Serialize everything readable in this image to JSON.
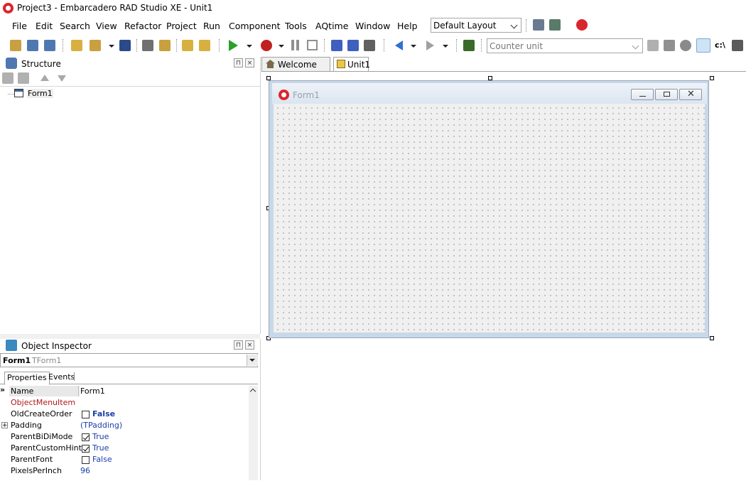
{
  "window": {
    "title": "Project3 - Embarcadero RAD Studio XE - Unit1"
  },
  "menu": [
    "File",
    "Edit",
    "Search",
    "View",
    "Refactor",
    "Project",
    "Run",
    "Component",
    "Tools",
    "AQtime",
    "Window",
    "Help"
  ],
  "toolbar": {
    "layout_combo": "Default Layout",
    "search_combo_placeholder": "Counter unit",
    "path_label": "c:\\"
  },
  "structure": {
    "title": "Structure",
    "tree_item": "Form1"
  },
  "tabs": [
    "Welcome Page",
    "Unit1"
  ],
  "designer": {
    "form_caption": "Form1"
  },
  "object_inspector": {
    "title": "Object Inspector",
    "selected_name": "Form1",
    "selected_type": "TForm1",
    "tabs": [
      "Properties",
      "Events"
    ],
    "properties": [
      {
        "name": "Name",
        "value": "Form1",
        "highlight": false,
        "checkbox": null,
        "bold": false
      },
      {
        "name": "ObjectMenuItem",
        "value": "",
        "highlight": true,
        "checkbox": null,
        "bold": false
      },
      {
        "name": "OldCreateOrder",
        "value": "False",
        "highlight": false,
        "checkbox": false,
        "bold": true
      },
      {
        "name": "Padding",
        "value": "(TPadding)",
        "highlight": false,
        "checkbox": null,
        "bold": false,
        "expandable": true
      },
      {
        "name": "ParentBiDiMode",
        "value": "True",
        "highlight": false,
        "checkbox": true,
        "bold": false
      },
      {
        "name": "ParentCustomHint",
        "value": "True",
        "highlight": false,
        "checkbox": true,
        "bold": false
      },
      {
        "name": "ParentFont",
        "value": "False",
        "highlight": false,
        "checkbox": false,
        "bold": false
      },
      {
        "name": "PixelsPerInch",
        "value": "96",
        "highlight": false,
        "checkbox": null,
        "bold": false
      }
    ]
  },
  "colors": {
    "accent_red": "#d9262c",
    "value_blue": "#1a3fa8",
    "highlight_red": "#b01818",
    "panel_bg": "#f0f0f0"
  }
}
